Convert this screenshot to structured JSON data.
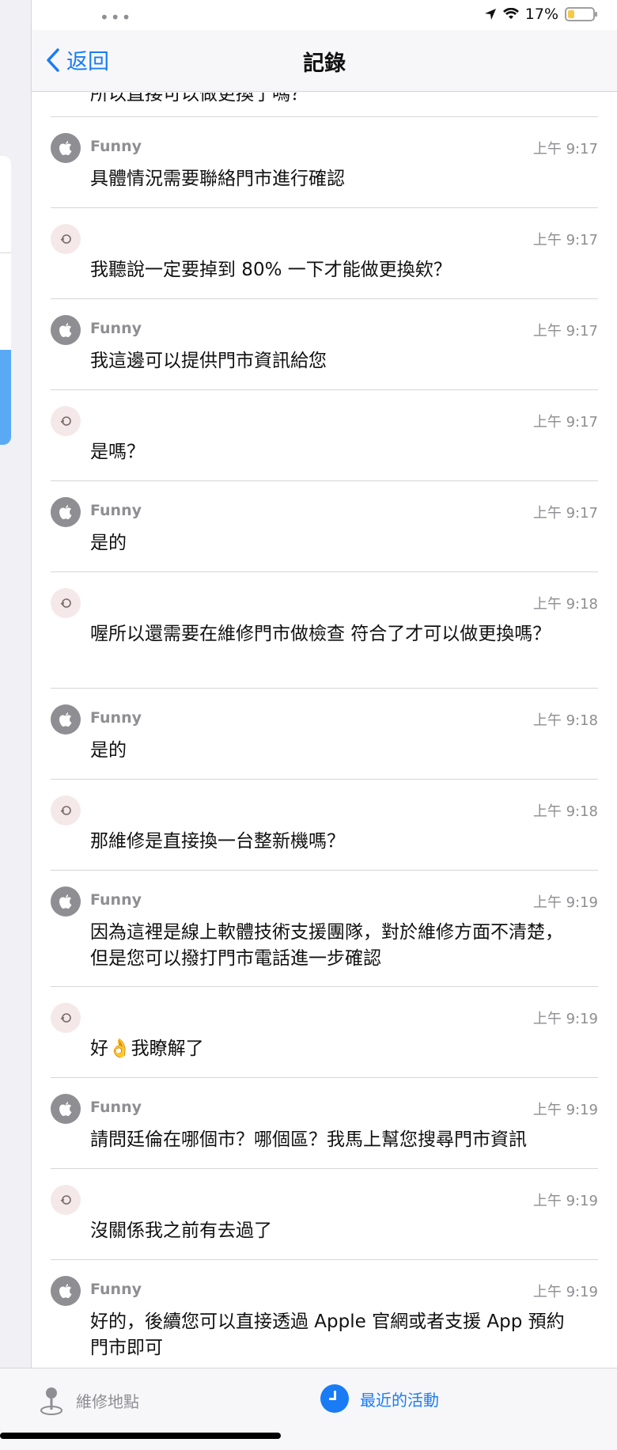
{
  "status_bar": {
    "battery": "17%"
  },
  "nav": {
    "back_label": "返回",
    "title": "記錄"
  },
  "partial_top_text": "所以直接可以做更換了嗎？",
  "messages": [
    {
      "sender": "Funny",
      "time": "上午 9:17",
      "text": "具體情況需要聯絡門市進行確認",
      "avatar": "apple-icon"
    },
    {
      "sender": "",
      "time": "上午 9:17",
      "text": "我聽說一定要掉到 80% 一下才能做更換欸？",
      "avatar": "user-avatar"
    },
    {
      "sender": "Funny",
      "time": "上午 9:17",
      "text": "我這邊可以提供門市資訊給您",
      "avatar": "apple-icon"
    },
    {
      "sender": "",
      "time": "上午 9:17",
      "text": "是嗎？",
      "avatar": "user-avatar"
    },
    {
      "sender": "Funny",
      "time": "上午 9:17",
      "text": "是的",
      "avatar": "apple-icon"
    },
    {
      "sender": "",
      "time": "上午 9:18",
      "text": "喔所以還需要在維修門市做檢查 符合了才可以做更換嗎？",
      "avatar": "user-avatar"
    },
    {
      "sender": "Funny",
      "time": "上午 9:18",
      "text": "是的",
      "avatar": "apple-icon"
    },
    {
      "sender": "",
      "time": "上午 9:18",
      "text": "那維修是直接換一台整新機嗎？",
      "avatar": "user-avatar"
    },
    {
      "sender": "Funny",
      "time": "上午 9:19",
      "text": "因為這裡是線上軟體技術支援團隊，對於維修方面不清楚，但是您可以撥打門市電話進一步確認",
      "avatar": "apple-icon"
    },
    {
      "sender": "",
      "time": "上午 9:19",
      "text": "好👌我瞭解了",
      "avatar": "user-avatar"
    },
    {
      "sender": "Funny",
      "time": "上午 9:19",
      "text": "請問廷倫在哪個市？哪個區？我馬上幫您搜尋門市資訊",
      "avatar": "apple-icon"
    },
    {
      "sender": "",
      "time": "上午 9:19",
      "text": "沒關係我之前有去過了",
      "avatar": "user-avatar"
    },
    {
      "sender": "Funny",
      "time": "上午 9:19",
      "text": "好的，後續您可以直接透過 Apple 官網或者支援 App 預約門市即可",
      "avatar": "apple-icon"
    }
  ],
  "tabbar": {
    "tab1_label": "維修地點",
    "tab2_label": "最近的活動"
  },
  "colors": {
    "accent": "#1a7cf5",
    "secondary_text": "#8e8e93"
  }
}
